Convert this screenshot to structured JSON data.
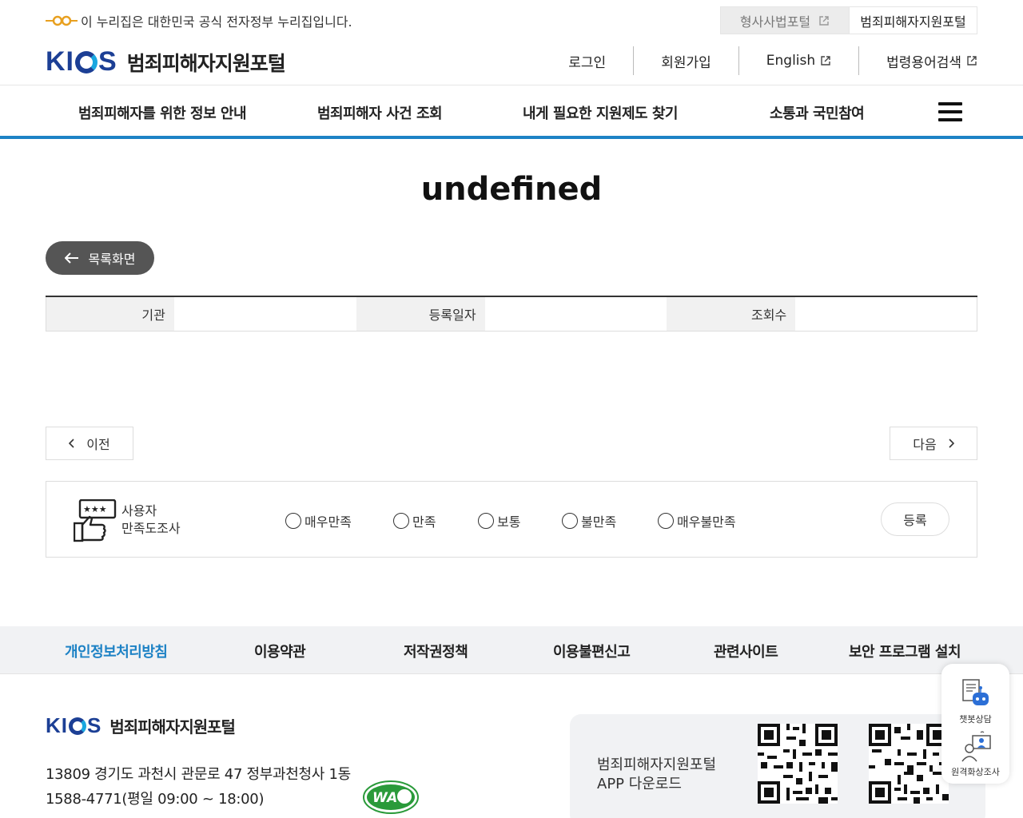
{
  "gov_banner": {
    "text": "이 누리집은 대한민국 공식 전자정부 누리집입니다."
  },
  "top_links": [
    {
      "label": "형사사법포털"
    },
    {
      "label": "범죄피해자지원포털"
    }
  ],
  "brand": {
    "logo_text": "KICS",
    "name": "범죄피해자지원포털"
  },
  "util_nav": [
    {
      "label": "로그인"
    },
    {
      "label": "회원가입"
    },
    {
      "label": "English"
    },
    {
      "label": "법령용어검색"
    }
  ],
  "gnb": [
    {
      "label": "범죄피해자를 위한 정보 안내"
    },
    {
      "label": "범죄피해자 사건 조회"
    },
    {
      "label": "내게 필요한 지원제도 찾기"
    },
    {
      "label": "소통과 국민참여"
    }
  ],
  "page_title": "undefined",
  "back_button": "목록화면",
  "meta": {
    "org_label": "기관",
    "date_label": "등록일자",
    "views_label": "조회수"
  },
  "pager": {
    "prev": "이전",
    "next": "다음"
  },
  "survey": {
    "label_line1": "사용자",
    "label_line2": "만족도조사",
    "options": [
      "매우만족",
      "만족",
      "보통",
      "불만족",
      "매우불만족"
    ],
    "submit": "등록"
  },
  "footer_nav": [
    {
      "label": "개인정보처리방침"
    },
    {
      "label": "이용약관"
    },
    {
      "label": "저작권정책"
    },
    {
      "label": "이용불편신고"
    },
    {
      "label": "관련사이트"
    },
    {
      "label": "보안 프로그램 설치"
    }
  ],
  "footer": {
    "address": "13809 경기도 과천시 관문로 47 정부과천청사 1동",
    "phone": "1588-4771(평일 09:00 ~ 18:00)",
    "app_line1": "범죄피해자지원포털",
    "app_line2": "APP 다운로드"
  },
  "float": {
    "chatbot": "챗봇상담",
    "video": "원격화상조사"
  },
  "colors": {
    "accent": "#1d82c5",
    "brand": "#1c3f95",
    "dark_button": "#555555"
  }
}
